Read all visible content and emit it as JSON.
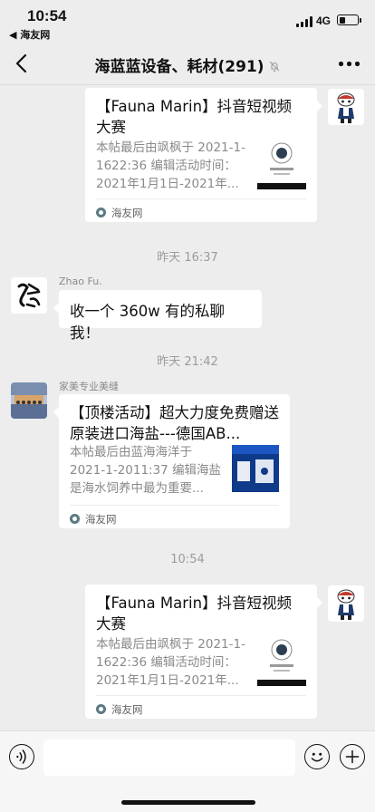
{
  "status_bar": {
    "time": "10:54",
    "back_app": "◀ 海友网",
    "network": "4G",
    "battery_level": 0.45
  },
  "header": {
    "title": "海蓝蓝设备、耗材(291)"
  },
  "messages": {
    "card1": {
      "title": "【Fauna Marin】抖音短视频大赛",
      "desc": "本帖最后由飒枫于 2021-1-1622:36 编辑活动时间：2021年1月1日-2021年...",
      "source": "海友网"
    },
    "ts1": "昨天 16:37",
    "msg_zhao": {
      "sender": "Zhao Fu.",
      "text": "收一个 360w 有的私聊我！"
    },
    "ts2": "昨天 21:42",
    "card2": {
      "sender": "家美专业美缝",
      "title": "【顶楼活动】超大力度免费赠送原装进口海盐---德国AB...",
      "desc": "本帖最后由蓝海海洋于 2021-1-2011:37 编辑海盐是海水饲养中最为重要...",
      "source": "海友网"
    },
    "ts3": "10:54",
    "card3": {
      "title": "【Fauna Marin】抖音短视频大赛",
      "desc": "本帖最后由飒枫于 2021-1-1622:36 编辑活动时间：2021年1月1日-2021年...",
      "source": "海友网"
    }
  },
  "colors": {
    "background": "#ededed",
    "bubble": "#ffffff",
    "timestamp": "#9b9b9b",
    "input_bar": "#f6f6f6"
  },
  "icons": [
    "back-chevron-icon",
    "mute-bell-icon",
    "more-dots-icon",
    "voice-icon",
    "emoji-icon",
    "plus-icon",
    "source-logo-icon"
  ]
}
